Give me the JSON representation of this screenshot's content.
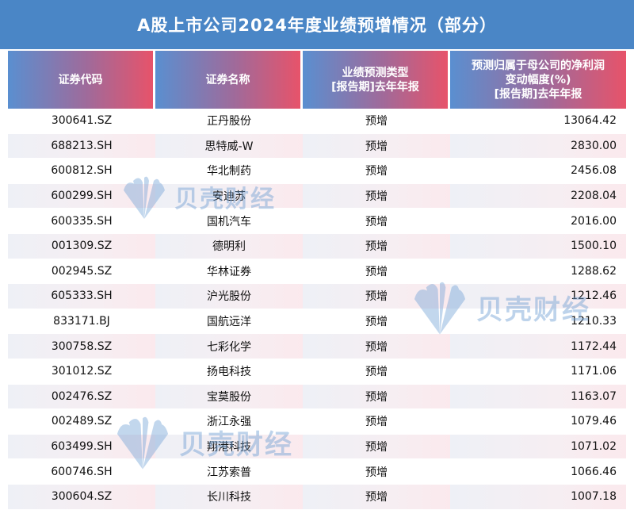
{
  "title": "A股上市公司2024年度业绩预增情况（部分）",
  "watermark": "贝壳财经",
  "colors": {
    "title_bg": "#4a86c6",
    "header_left": "#5a8fd0",
    "header_right": "#e7536a"
  },
  "chart_data": {
    "type": "table",
    "columns": [
      "证券代码",
      "证券名称",
      "业绩预测类型\n[报告期]去年年报",
      "预测归属于母公司的净利润\n变动幅度(%)\n[报告期]去年年报"
    ],
    "rows": [
      [
        "300641.SZ",
        "正丹股份",
        "预增",
        "13064.42"
      ],
      [
        "688213.SH",
        "思特威-W",
        "预增",
        "2830.00"
      ],
      [
        "600812.SH",
        "华北制药",
        "预增",
        "2456.08"
      ],
      [
        "600299.SH",
        "安迪苏",
        "预增",
        "2208.04"
      ],
      [
        "600335.SH",
        "国机汽车",
        "预增",
        "2016.00"
      ],
      [
        "001309.SZ",
        "德明利",
        "预增",
        "1500.10"
      ],
      [
        "002945.SZ",
        "华林证券",
        "预增",
        "1288.62"
      ],
      [
        "605333.SH",
        "沪光股份",
        "预增",
        "1212.46"
      ],
      [
        "833171.BJ",
        "国航远洋",
        "预增",
        "1210.33"
      ],
      [
        "300758.SZ",
        "七彩化学",
        "预增",
        "1172.44"
      ],
      [
        "301012.SZ",
        "扬电科技",
        "预增",
        "1171.06"
      ],
      [
        "002476.SZ",
        "宝莫股份",
        "预增",
        "1163.07"
      ],
      [
        "002489.SZ",
        "浙江永强",
        "预增",
        "1079.46"
      ],
      [
        "603499.SH",
        "翔港科技",
        "预增",
        "1071.02"
      ],
      [
        "600746.SH",
        "江苏索普",
        "预增",
        "1066.46"
      ],
      [
        "300604.SZ",
        "长川科技",
        "预增",
        "1007.18"
      ]
    ]
  }
}
